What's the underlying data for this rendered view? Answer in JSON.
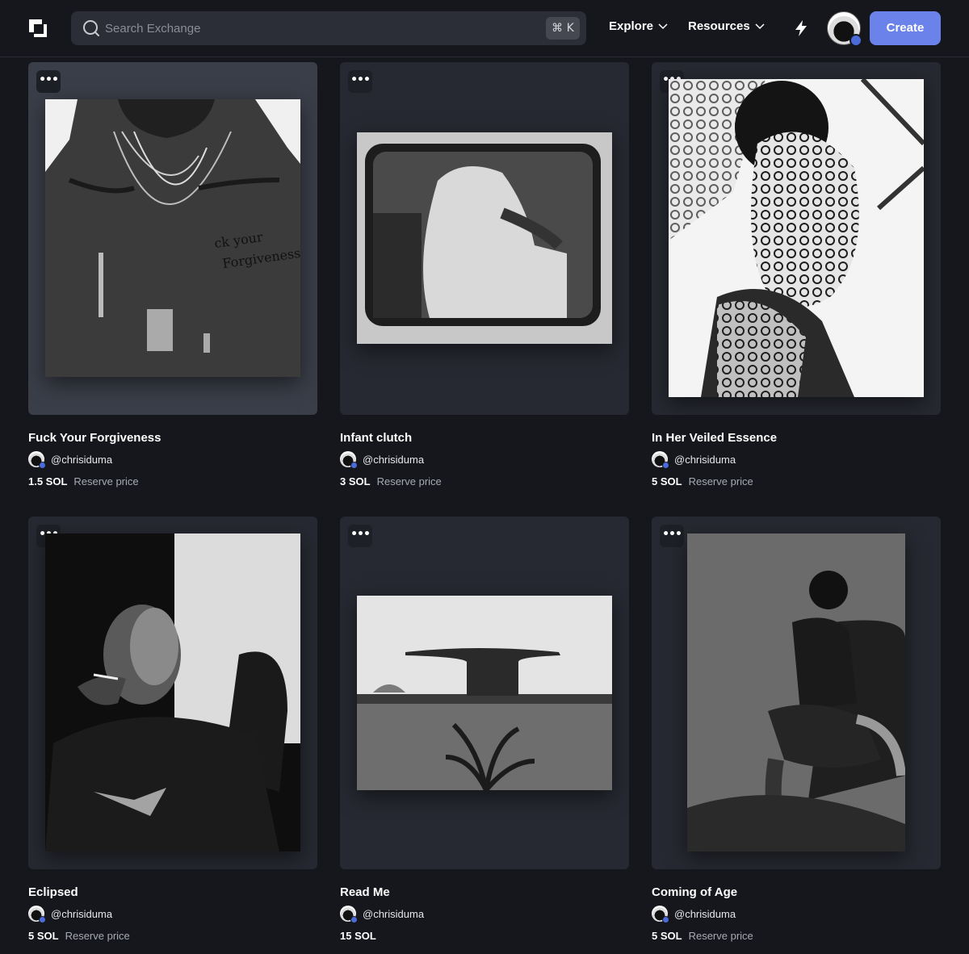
{
  "header": {
    "search_placeholder": "Search Exchange",
    "shortcut": "⌘ K",
    "nav": [
      {
        "label": "Explore"
      },
      {
        "label": "Resources"
      }
    ],
    "create_label": "Create"
  },
  "colors": {
    "background": "#15171d",
    "card": "#262931",
    "card_highlight": "#3a3e48",
    "accent": "#6a82ea",
    "verified": "#4b6bd8"
  },
  "cards": [
    {
      "title": "Fuck Your Forgiveness",
      "creator": "@chrisiduma",
      "price": "1.5 SOL",
      "price_label": "Reserve price"
    },
    {
      "title": "Infant clutch",
      "creator": "@chrisiduma",
      "price": "3 SOL",
      "price_label": "Reserve price"
    },
    {
      "title": "In Her Veiled Essence",
      "creator": "@chrisiduma",
      "price": "5 SOL",
      "price_label": "Reserve price"
    },
    {
      "title": "Eclipsed",
      "creator": "@chrisiduma",
      "price": "5 SOL",
      "price_label": "Reserve price"
    },
    {
      "title": "Read Me",
      "creator": "@chrisiduma",
      "price": "15 SOL",
      "price_label": ""
    },
    {
      "title": "Coming of Age",
      "creator": "@chrisiduma",
      "price": "5 SOL",
      "price_label": "Reserve price"
    }
  ]
}
